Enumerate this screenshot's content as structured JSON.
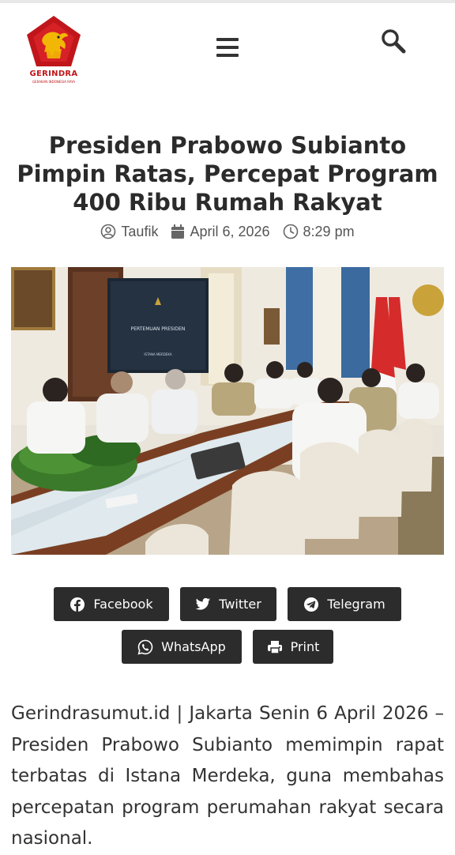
{
  "header": {
    "logo_text": "GERINDRA",
    "logo_subtext": "GERAKAN INDONESIA RAYA",
    "menu_icon": "hamburger-menu-icon",
    "search_icon": "search-icon"
  },
  "article": {
    "title": "Presiden Prabowo Subianto Pimpin Ratas, Percepat Program 400 Ribu Rumah Rakyat",
    "author": "Taufik",
    "date": "April 6, 2026",
    "time": "8:29 pm",
    "photo_screen_title": "PERTEMUAN PRESIDEN",
    "photo_screen_sub": "ISTANA MERDEKA",
    "body": "Gerindrasumut.id | Jakarta Senin 6 April 2026 – Presiden Prabowo Subianto memimpin rapat terbatas di Istana Merdeka, guna membahas percepatan program perumahan rakyat secara nasional."
  },
  "share": {
    "facebook": "Facebook",
    "twitter": "Twitter",
    "telegram": "Telegram",
    "whatsapp": "WhatsApp",
    "print": "Print"
  },
  "colors": {
    "brand_red": "#c0161b",
    "button_bg": "#2c2c2c",
    "title_text": "#2b2b2b"
  }
}
